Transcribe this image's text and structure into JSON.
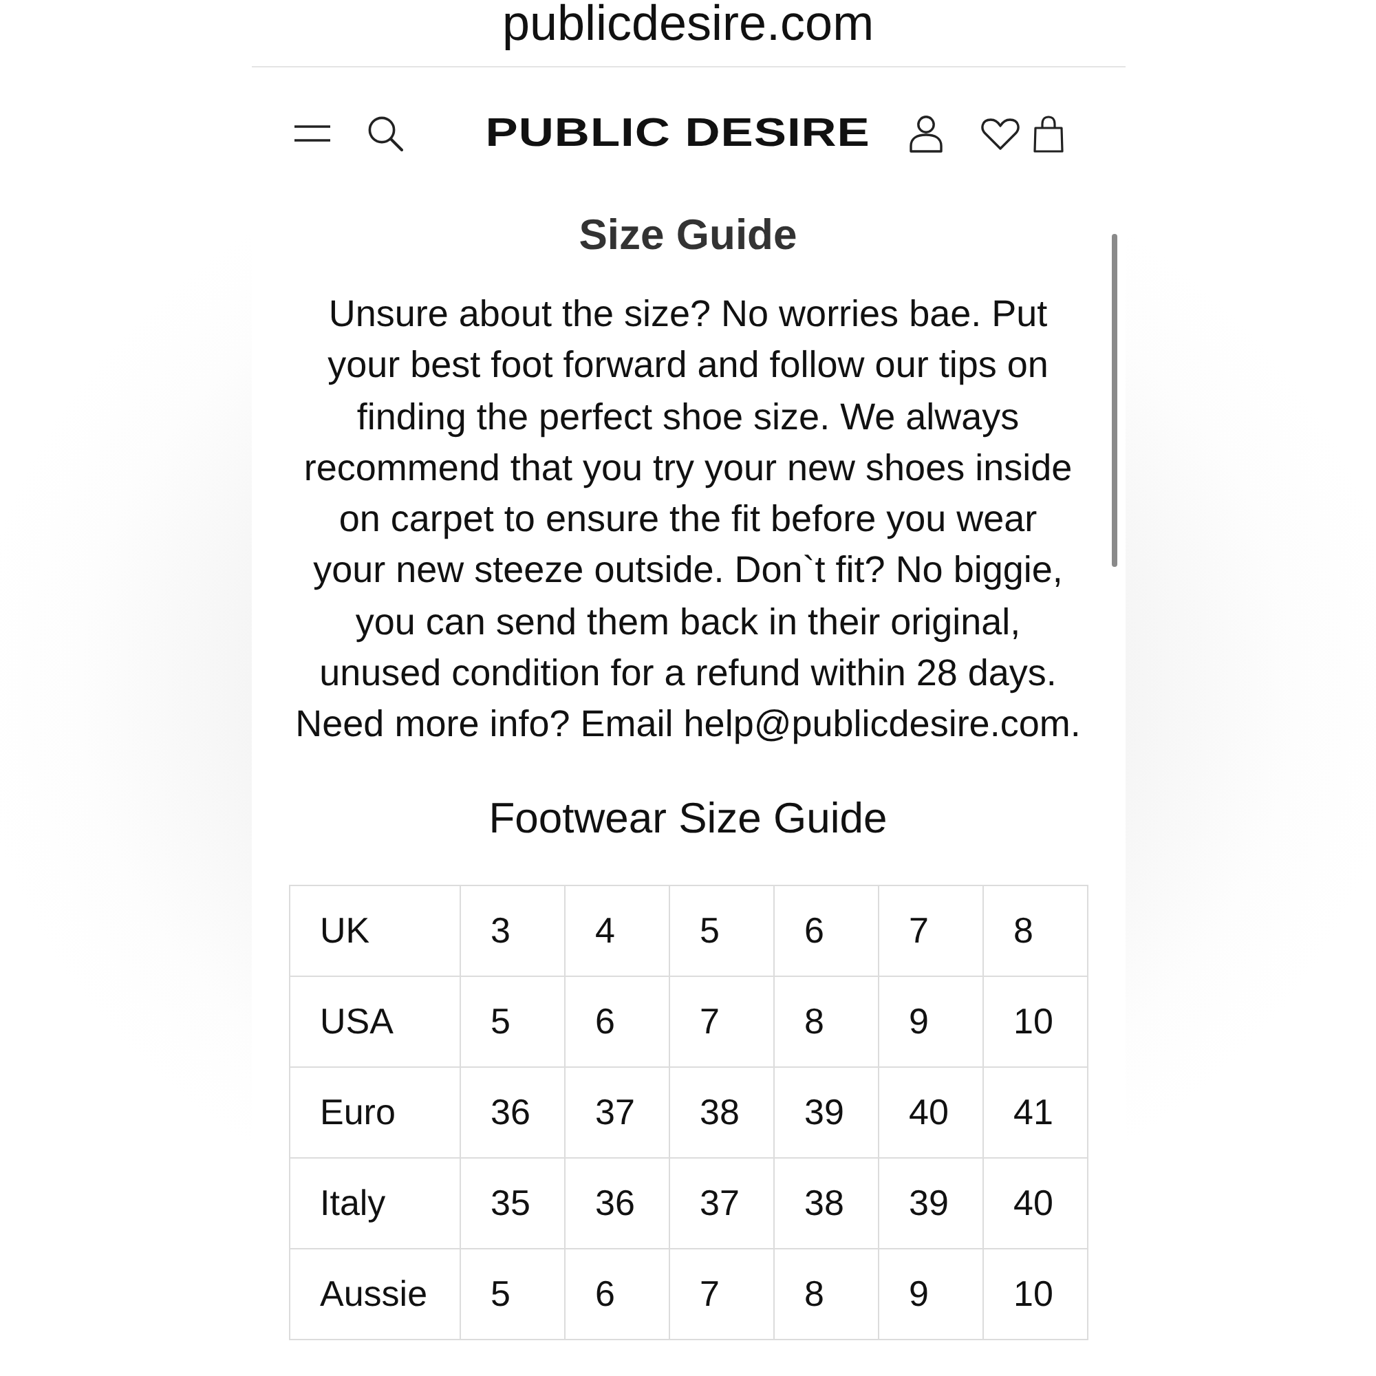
{
  "browser": {
    "url": "publicdesire.com"
  },
  "header": {
    "logo": "PUBLIC DESIRE"
  },
  "content": {
    "title": "Size Guide",
    "intro": "Unsure about the size? No worries bae. Put\nyour best foot forward and follow our tips on\nfinding the perfect shoe size. We always\nrecommend that you try your new shoes inside\non carpet to ensure the fit before you wear\nyour new steeze outside. Don`t fit? No biggie,\nyou can send them back in their original,\nunused condition for a refund within 28 days.\nNeed more info? Email help@publicdesire.com.",
    "table_title": "Footwear Size Guide"
  },
  "size_table": {
    "rows": [
      {
        "label": "UK",
        "sizes": [
          "3",
          "4",
          "5",
          "6",
          "7",
          "8"
        ]
      },
      {
        "label": "USA",
        "sizes": [
          "5",
          "6",
          "7",
          "8",
          "9",
          "10"
        ]
      },
      {
        "label": "Euro",
        "sizes": [
          "36",
          "37",
          "38",
          "39",
          "40",
          "41"
        ]
      },
      {
        "label": "Italy",
        "sizes": [
          "35",
          "36",
          "37",
          "38",
          "39",
          "40"
        ]
      },
      {
        "label": "Aussie",
        "sizes": [
          "5",
          "6",
          "7",
          "8",
          "9",
          "10"
        ]
      }
    ]
  }
}
